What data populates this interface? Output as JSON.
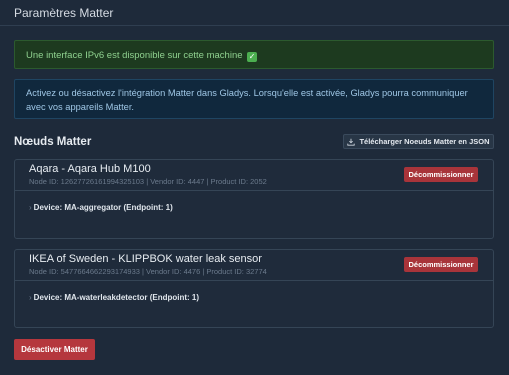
{
  "page": {
    "title": "Paramètres Matter"
  },
  "alerts": {
    "ipv6": "Une interface IPv6 est disponible sur cette machine",
    "ipv6_icon": "check-mark-icon",
    "info": "Activez ou désactivez l'intégration Matter dans Gladys. Lorsqu'elle est activée, Gladys pourra communiquer avec vos appareils Matter."
  },
  "nodes_section": {
    "title": "Nœuds Matter",
    "download_label": "Télécharger Noeuds Matter en JSON",
    "download_icon": "download-icon"
  },
  "nodes": [
    {
      "name": "Aqara - Aqara Hub M100",
      "meta": "Node ID: 12627726161994325103 | Vendor ID: 4447 | Product ID: 2052",
      "decommission_label": "Décommissionner",
      "device": "Device: MA-aggregator (Endpoint: 1)"
    },
    {
      "name": "IKEA of Sweden - KLIPPBOK water leak sensor",
      "meta": "Node ID: 5477664662293174933 | Vendor ID: 4476 | Product ID: 32774",
      "decommission_label": "Décommissionner",
      "device": "Device: MA-waterleakdetector (Endpoint: 1)"
    }
  ],
  "actions": {
    "deactivate_label": "Désactiver Matter"
  },
  "colors": {
    "background": "#1e2a3a",
    "danger": "#b5373d",
    "success_text": "#8fd18f",
    "info_text": "#9fc7e6"
  }
}
